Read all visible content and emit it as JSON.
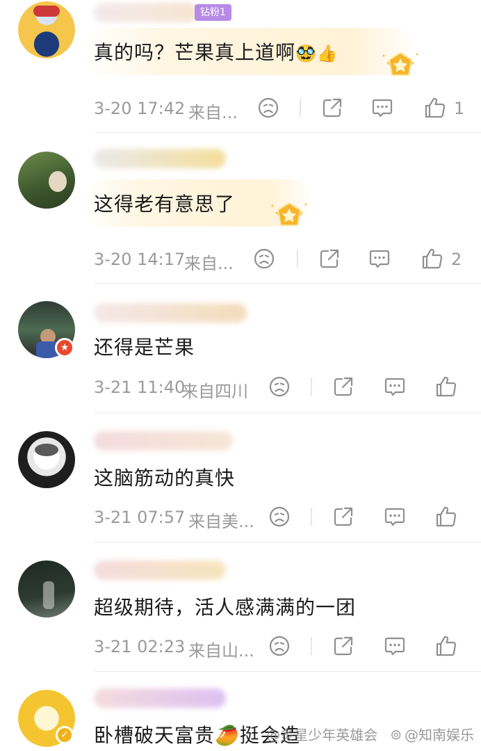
{
  "comments": [
    {
      "fan_badge": "钻粉1",
      "text": "真的吗？芒果真上道啊",
      "emoji": "🥸👍",
      "time": "3-20 17:42",
      "location": "来自...",
      "likes": "1"
    },
    {
      "text": "这得老有意思了",
      "time": "3-20 14:17",
      "location": "来自...",
      "likes": "2"
    },
    {
      "text": "还得是芒果",
      "time": "3-21 11:40",
      "location": "来自四川",
      "likes": ""
    },
    {
      "text": "这脑筋动的真快",
      "time": "3-21 07:57",
      "location": "来自美...",
      "likes": ""
    },
    {
      "text": "超级期待，活人感满满的一团",
      "time": "3-21 02:23",
      "location": "来自山...",
      "likes": ""
    },
    {
      "text": "卧槽破天富贵🥭挺会造",
      "time": "",
      "location": "",
      "likes": ""
    }
  ],
  "watermark": {
    "left": "@炙星少年英雄会",
    "right": "@知南娱乐"
  },
  "icons": [
    "frown-icon",
    "share-icon",
    "comment-icon",
    "thumbs-up-icon",
    "medal-icon",
    "verified-icon"
  ],
  "colors": {
    "bubble": "#fff2d6",
    "meta_text": "#9a9a9a",
    "fan_badge": "#b78ae6",
    "location_badge": "#e8472d"
  }
}
